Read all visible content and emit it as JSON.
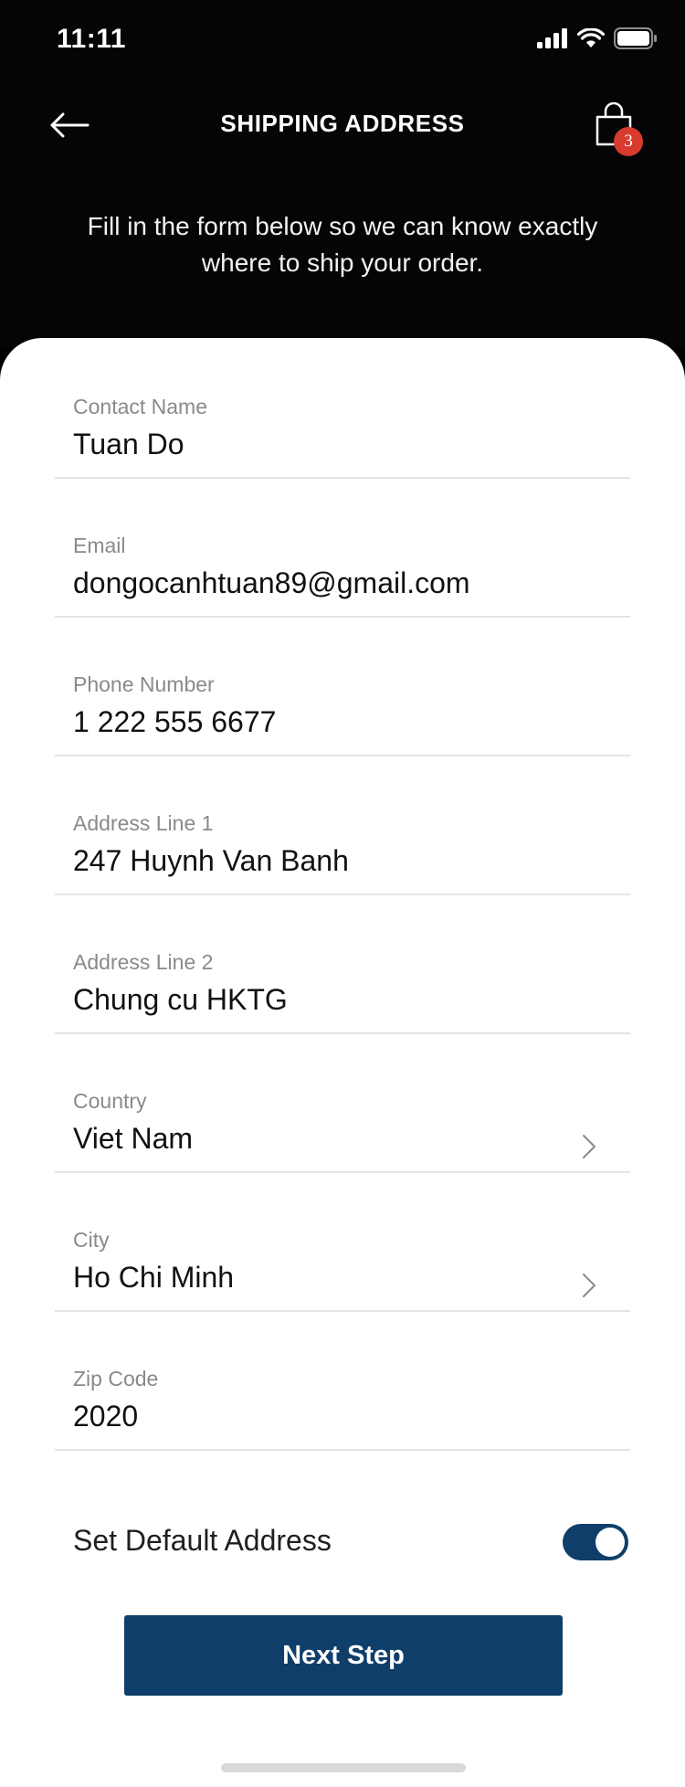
{
  "status_bar": {
    "time": "11:11",
    "icons": [
      "signal-icon",
      "wifi-icon",
      "battery-icon"
    ]
  },
  "header": {
    "title": "SHIPPING ADDRESS",
    "subtitle": "Fill in the form below so we can know exactly where to ship your order.",
    "cart_count": "3",
    "back_icon": "arrow-left-icon",
    "cart_icon": "shopping-bag-icon"
  },
  "form": {
    "fields": [
      {
        "label": "Contact Name",
        "value": "Tuan Do"
      },
      {
        "label": "Email",
        "value": "dongocanhtuan89@gmail.com"
      },
      {
        "label": "Phone Number",
        "value": "1 222 555 6677"
      },
      {
        "label": "Address Line 1",
        "value": "247 Huynh Van Banh"
      },
      {
        "label": "Address Line 2",
        "value": "Chung cu HKTG"
      },
      {
        "label": "Country",
        "value": "Viet Nam"
      },
      {
        "label": "City",
        "value": "Ho Chi Minh"
      },
      {
        "label": "Zip Code",
        "value": "2020"
      }
    ],
    "default_address": {
      "label": "Set Default Address",
      "enabled": true
    },
    "next_button": "Next Step"
  },
  "colors": {
    "header_bg": "#050507",
    "accent": "#0f3e6a",
    "badge": "#d83a2c"
  }
}
